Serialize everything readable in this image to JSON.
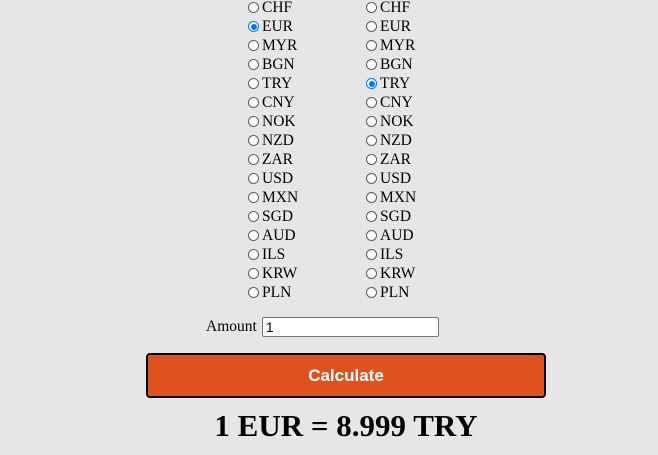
{
  "from_currency": {
    "selected": "EUR",
    "options": [
      "CHF",
      "EUR",
      "MYR",
      "BGN",
      "TRY",
      "CNY",
      "NOK",
      "NZD",
      "ZAR",
      "USD",
      "MXN",
      "SGD",
      "AUD",
      "ILS",
      "KRW",
      "PLN"
    ]
  },
  "to_currency": {
    "selected": "TRY",
    "options": [
      "CHF",
      "EUR",
      "MYR",
      "BGN",
      "TRY",
      "CNY",
      "NOK",
      "NZD",
      "ZAR",
      "USD",
      "MXN",
      "SGD",
      "AUD",
      "ILS",
      "KRW",
      "PLN"
    ]
  },
  "amount": {
    "label": "Amount",
    "value": "1"
  },
  "calculate_button": {
    "label": "Calculate",
    "color": "#dd521e"
  },
  "result": {
    "text": "1 EUR = 8.999 TRY"
  }
}
